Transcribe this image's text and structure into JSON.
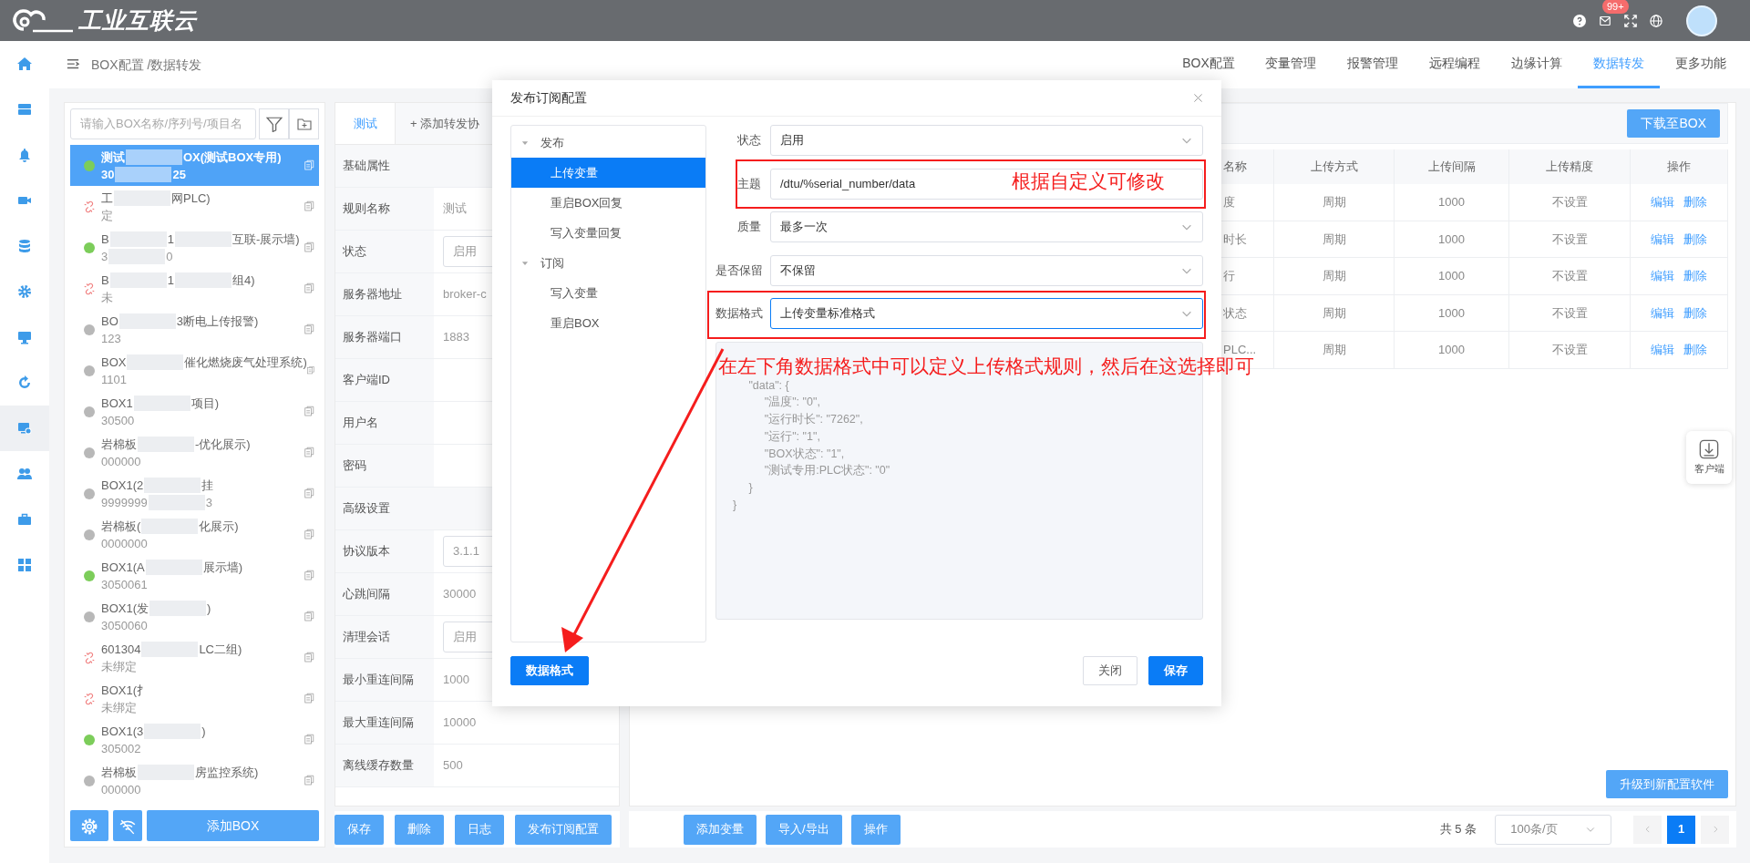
{
  "header": {
    "logo_text": "工业互联云",
    "mail_badge": "99+"
  },
  "rail": [
    {
      "selected": false
    },
    {
      "selected": false
    },
    {
      "selected": false
    },
    {
      "selected": false
    },
    {
      "selected": false
    },
    {
      "selected": false
    },
    {
      "selected": false
    },
    {
      "selected": false
    },
    {
      "selected": true
    },
    {
      "selected": false
    },
    {
      "selected": false
    },
    {
      "selected": false
    }
  ],
  "breadcrumb": "BOX配置 /数据转发",
  "top_tabs": [
    {
      "label": "BOX配置",
      "selected": false
    },
    {
      "label": "变量管理",
      "selected": false
    },
    {
      "label": "报警管理",
      "selected": false
    },
    {
      "label": "远程编程",
      "selected": false
    },
    {
      "label": "边缘计算",
      "selected": false
    },
    {
      "label": "数据转发",
      "selected": true
    },
    {
      "label": "更多功能",
      "selected": false
    }
  ],
  "box_list": {
    "search_placeholder": "请输入BOX名称/序列号/项目名",
    "add_button": "添加BOX",
    "items": [
      {
        "kind": "online",
        "selected": true,
        "name": [
          "测试",
          "OX(测试BOX专用)"
        ],
        "serial": [
          "30",
          "25"
        ]
      },
      {
        "kind": "unbound",
        "selected": false,
        "name": [
          "工",
          "网PLC)"
        ],
        "serial": [
          "定"
        ]
      },
      {
        "kind": "online",
        "selected": false,
        "name": [
          "B",
          "1",
          "互联-展示墙)"
        ],
        "serial": [
          "3",
          "0"
        ]
      },
      {
        "kind": "unbound",
        "selected": false,
        "name": [
          "B",
          "1",
          "组4)"
        ],
        "serial": [
          "未"
        ]
      },
      {
        "kind": "offline",
        "selected": false,
        "name": [
          "BO",
          "3断电上传报警)"
        ],
        "serial": [
          "123"
        ]
      },
      {
        "kind": "offline",
        "selected": false,
        "name": [
          "BOX",
          "催化燃烧废气处理系统)"
        ],
        "serial": [
          "1101"
        ]
      },
      {
        "kind": "offline",
        "selected": false,
        "name": [
          "BOX1",
          "项目)"
        ],
        "serial": [
          "30500"
        ]
      },
      {
        "kind": "offline",
        "selected": false,
        "name": [
          "岩棉板",
          "-优化展示)"
        ],
        "serial": [
          "000000"
        ]
      },
      {
        "kind": "offline",
        "selected": false,
        "name": [
          "BOX1(2",
          "挂"
        ],
        "serial": [
          "9999999",
          "3"
        ]
      },
      {
        "kind": "offline",
        "selected": false,
        "name": [
          "岩棉板(",
          "化展示)"
        ],
        "serial": [
          "0000000"
        ]
      },
      {
        "kind": "online",
        "selected": false,
        "name": [
          "BOX1(A",
          "展示墙)"
        ],
        "serial": [
          "3050061"
        ]
      },
      {
        "kind": "offline",
        "selected": false,
        "name": [
          "BOX1(发",
          ")"
        ],
        "serial": [
          "3050060"
        ]
      },
      {
        "kind": "unbound",
        "selected": false,
        "name": [
          "601304",
          "LC二组)"
        ],
        "serial": [
          "未绑定"
        ]
      },
      {
        "kind": "unbound",
        "selected": false,
        "name": [
          "BOX1(扌"
        ],
        "serial": [
          "未绑定"
        ]
      },
      {
        "kind": "online",
        "selected": false,
        "name": [
          "BOX1(3",
          ")"
        ],
        "serial": [
          "305002"
        ]
      },
      {
        "kind": "offline",
        "selected": false,
        "name": [
          "岩棉板",
          "房监控系统)"
        ],
        "serial": [
          "000000"
        ]
      }
    ]
  },
  "rule_tabs": [
    {
      "label": "测试",
      "selected": true
    },
    {
      "label": "+ 添加转发协",
      "selected": false
    }
  ],
  "properties": [
    {
      "kind": "section",
      "label": "基础属性"
    },
    {
      "kind": "text",
      "label": "规则名称",
      "value": "测试"
    },
    {
      "kind": "select",
      "label": "状态",
      "value": "启用"
    },
    {
      "kind": "text",
      "label": "服务器地址",
      "value": "broker-c"
    },
    {
      "kind": "text",
      "label": "服务器端口",
      "value": "1883"
    },
    {
      "kind": "text",
      "label": "客户端ID"
    },
    {
      "kind": "text",
      "label": "用户名"
    },
    {
      "kind": "text",
      "label": "密码"
    },
    {
      "kind": "section",
      "label": "高级设置"
    },
    {
      "kind": "select",
      "label": "协议版本",
      "value": "3.1.1"
    },
    {
      "kind": "text",
      "label": "心跳间隔",
      "value": "30000"
    },
    {
      "kind": "select",
      "label": "清理会话",
      "value": "启用"
    },
    {
      "kind": "text",
      "label": "最小重连间隔",
      "value": "1000"
    },
    {
      "kind": "text",
      "label": "最大重连间隔",
      "value": "10000"
    },
    {
      "kind": "text",
      "label": "离线缓存数量",
      "value": "500"
    }
  ],
  "rule_buttons": [
    "保存",
    "删除",
    "日志",
    "发布订阅配置"
  ],
  "toolbar_button": "下载至BOX",
  "table": {
    "columns": [
      "名称",
      "上传方式",
      "上传间隔",
      "上传精度",
      "操作"
    ],
    "rows": [
      {
        "cells": [
          "度",
          "周期",
          "1000",
          "不设置"
        ],
        "actions": [
          "编辑",
          "删除"
        ]
      },
      {
        "cells": [
          "时长",
          "周期",
          "1000",
          "不设置"
        ],
        "actions": [
          "编辑",
          "删除"
        ]
      },
      {
        "cells": [
          "行",
          "周期",
          "1000",
          "不设置"
        ],
        "actions": [
          "编辑",
          "删除"
        ]
      },
      {
        "cells": [
          "状态",
          "周期",
          "1000",
          "不设置"
        ],
        "actions": [
          "编辑",
          "删除"
        ]
      },
      {
        "cells": [
          "PLC...",
          "周期",
          "1000",
          "不设置"
        ],
        "actions": [
          "编辑",
          "删除"
        ]
      }
    ]
  },
  "upgrade_button": "升级到新配置软件",
  "variable_buttons": [
    "添加变量",
    "导入/导出",
    "操作"
  ],
  "pager": {
    "total": "共 5 条",
    "page_size": "100条/页",
    "pages": [
      {
        "label": "1",
        "selected": true
      }
    ]
  },
  "client_widget": "客户端",
  "modal": {
    "title": "发布订阅配置",
    "tree": [
      {
        "label": "发布",
        "expanded": true,
        "children": [
          {
            "label": "上传变量",
            "selected": true
          },
          {
            "label": "重启BOX回复",
            "selected": false
          },
          {
            "label": "写入变量回复",
            "selected": false
          }
        ]
      },
      {
        "label": "订阅",
        "expanded": true,
        "children": [
          {
            "label": "写入变量",
            "selected": false
          },
          {
            "label": "重启BOX",
            "selected": false
          }
        ]
      }
    ],
    "fields": [
      {
        "kind": "select",
        "label": "状态",
        "value": "启用",
        "focused": false,
        "highlighted": false
      },
      {
        "kind": "input",
        "label": "主题",
        "value": "/dtu/%serial_number/data",
        "focused": false,
        "highlighted": true,
        "note": "根据自定义可修改"
      },
      {
        "kind": "select",
        "label": "质量",
        "value": "最多一次",
        "focused": false,
        "highlighted": false
      },
      {
        "kind": "select",
        "label": "是否保留",
        "value": "不保留",
        "focused": false,
        "highlighted": false
      },
      {
        "kind": "select",
        "label": "数据格式",
        "value": "上传变量标准格式",
        "focused": true,
        "highlighted": true,
        "note": "在左下角数据格式中可以定义上传格式规则，然后在这选择即可"
      }
    ],
    "preview": "\t\"data\": {\n\t\t\"温度\": \"0\",\n\t\t\"运行时长\": \"7262\",\n\t\t\"运行\": \"1\",\n\t\t\"BOX状态\": \"1\",\n\t\t\"测试专用:PLC状态\": \"0\"\n\t}\n}",
    "arrow": true,
    "footer_left": "数据格式",
    "footer_buttons": [
      {
        "label": "关闭",
        "kind": "default"
      },
      {
        "label": "保存",
        "kind": "primary"
      }
    ]
  }
}
